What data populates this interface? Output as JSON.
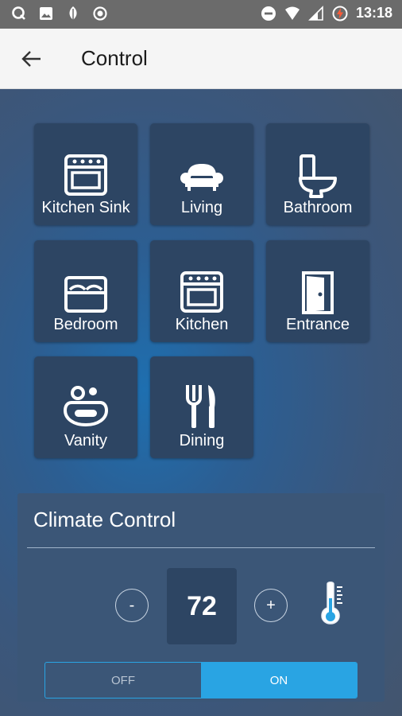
{
  "status_bar": {
    "time": "13:18",
    "left_icons": [
      "q-app-icon",
      "image-icon",
      "leaf-icon",
      "record-icon"
    ],
    "right_icons": [
      "do-not-disturb-icon",
      "wifi-icon",
      "signal-icon",
      "battery-charging-icon"
    ]
  },
  "app_bar": {
    "title": "Control"
  },
  "rooms": [
    {
      "label": "Kitchen Sink",
      "icon": "oven-icon"
    },
    {
      "label": "Living",
      "icon": "sofa-icon"
    },
    {
      "label": "Bathroom",
      "icon": "toilet-icon"
    },
    {
      "label": "Bedroom",
      "icon": "bed-icon"
    },
    {
      "label": "Kitchen",
      "icon": "oven-icon"
    },
    {
      "label": "Entrance",
      "icon": "door-icon"
    },
    {
      "label": "Vanity",
      "icon": "sink-icon"
    },
    {
      "label": "Dining",
      "icon": "cutlery-icon"
    }
  ],
  "climate": {
    "title": "Climate Control",
    "decrease_label": "-",
    "increase_label": "+",
    "temperature": "72",
    "thermometer_icon": "thermometer-icon",
    "off_label": "OFF",
    "on_label": "ON",
    "state": "ON"
  },
  "colors": {
    "accent": "#29a4e3",
    "tile": "#2d4563",
    "app_bar": "#f5f5f5"
  }
}
